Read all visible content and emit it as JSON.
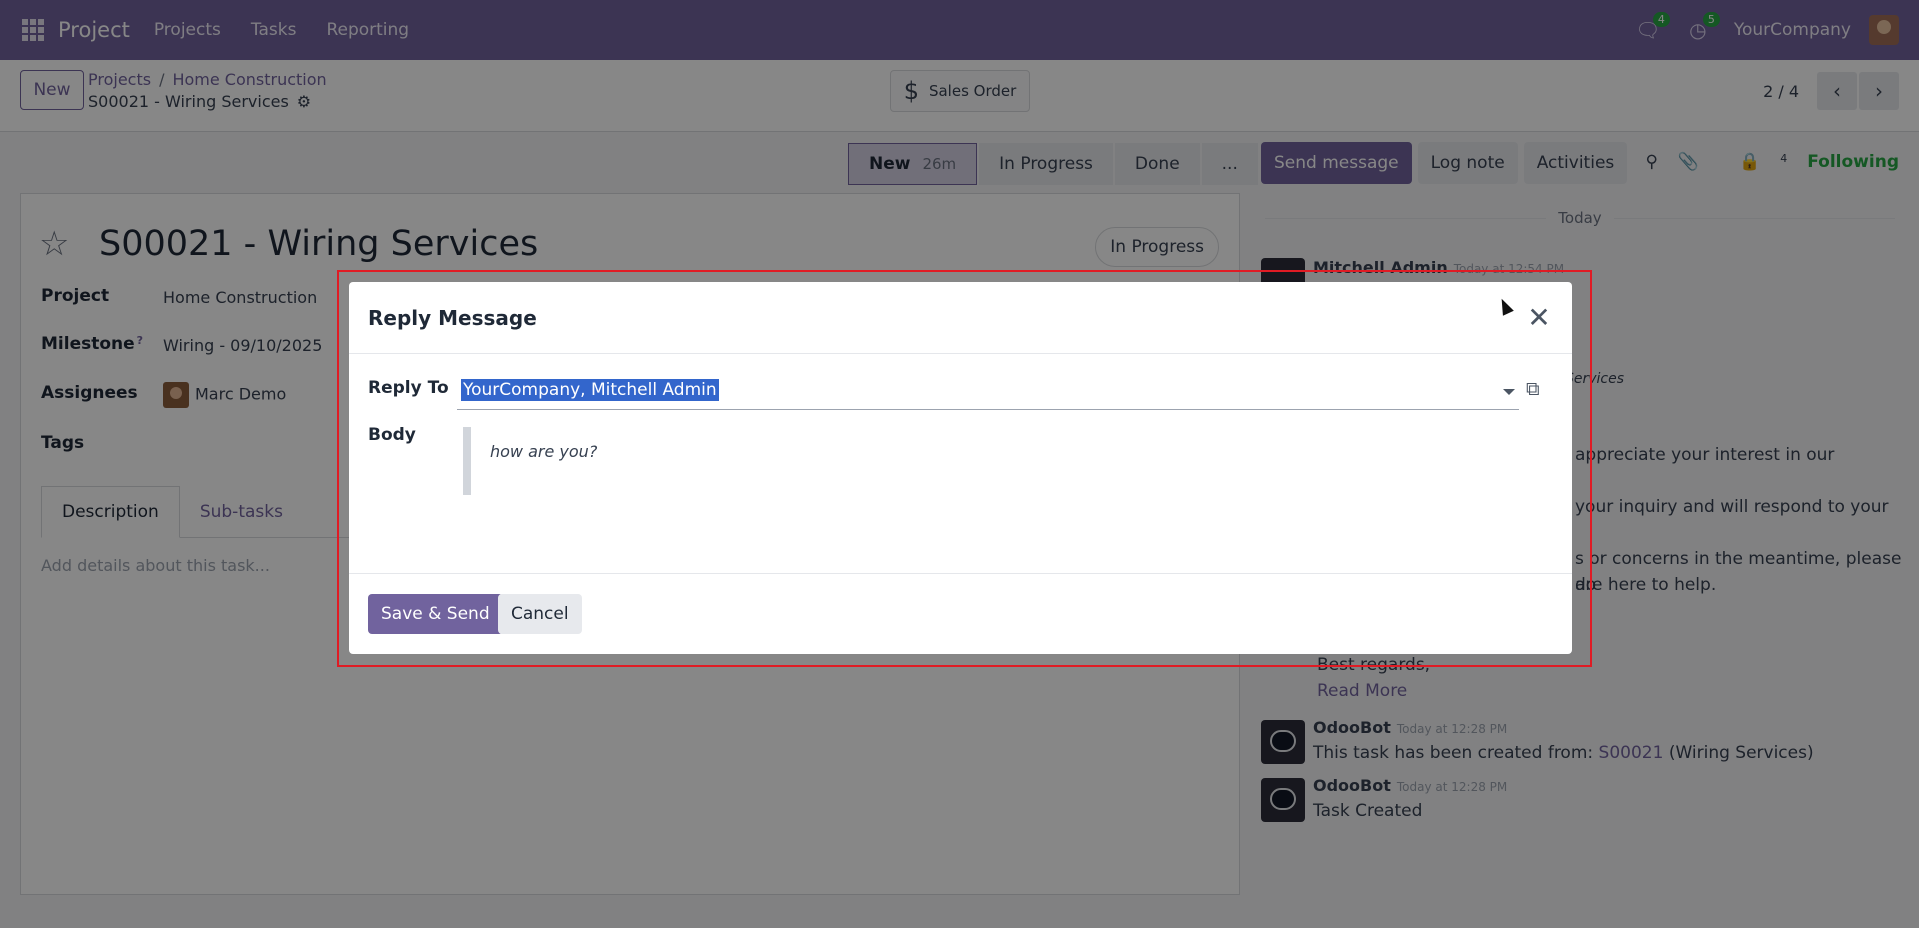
{
  "navbar": {
    "app_name": "Project",
    "menu": [
      "Projects",
      "Tasks",
      "Reporting"
    ],
    "messages_count": "4",
    "activities_count": "5",
    "company": "YourCompany"
  },
  "control": {
    "new_label": "New",
    "breadcrumb": [
      "Projects",
      "Home Construction"
    ],
    "breadcrumb_sep": "/",
    "current": "S00021 - Wiring Services",
    "sales_order_label": "Sales Order",
    "pager": "2 / 4"
  },
  "statusbar": {
    "stages": [
      "New",
      "In Progress",
      "Done",
      "..."
    ],
    "active_duration": "26m"
  },
  "form": {
    "title": "S00021 - Wiring Services",
    "state": "In Progress",
    "labels": {
      "project": "Project",
      "milestone": "Milestone",
      "assignees": "Assignees",
      "tags": "Tags"
    },
    "milestone_help": "?",
    "project": "Home Construction",
    "milestone": "Wiring - 09/10/2025",
    "assignee": "Marc Demo",
    "tabs": [
      "Description",
      "Sub-tasks"
    ],
    "description_placeholder": "Add details about this task..."
  },
  "chatter": {
    "buttons": [
      "Send message",
      "Log note",
      "Activities"
    ],
    "followers_count": "4",
    "following_label": "Following",
    "today_label": "Today",
    "messages": [
      {
        "author": "Mitchell Admin",
        "time": "Today at 12:54 PM",
        "fragments": [
          "Services",
          "appreciate your interest in our",
          "your inquiry and will respond to your",
          "s or concerns in the meantime, please do",
          "are here to help."
        ],
        "closing": "Best regards,",
        "read_more": "Read More"
      },
      {
        "author": "OdooBot",
        "time": "Today at 12:28 PM",
        "text_prefix": "This task has been created from:",
        "link": "S00021",
        "text_suffix": "(Wiring Services)"
      },
      {
        "author": "OdooBot",
        "time": "Today at 12:28 PM",
        "text": "Task Created"
      }
    ]
  },
  "modal": {
    "title": "Reply Message",
    "reply_to_label": "Reply To",
    "reply_to_value": "YourCompany, Mitchell Admin",
    "body_label": "Body",
    "body_text": "how are you?",
    "save_label": "Save & Send",
    "cancel_label": "Cancel"
  },
  "icons": {
    "close": "close-icon",
    "external": "external-link-icon",
    "star": "star-icon"
  },
  "colors": {
    "brand": "#71639e",
    "highlight": "#e01b24",
    "selection": "#3366cc",
    "following": "#28a745"
  }
}
